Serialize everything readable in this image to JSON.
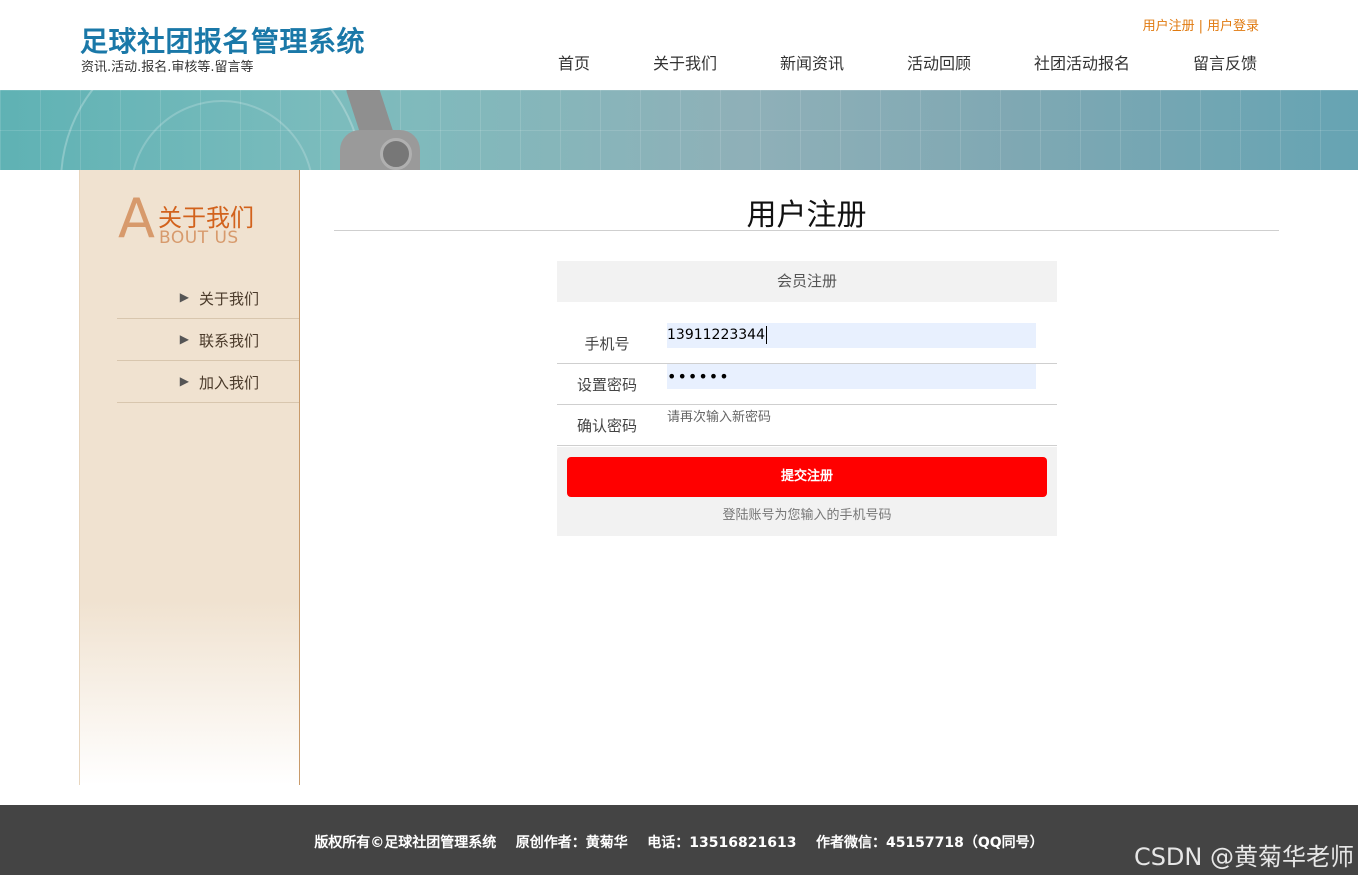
{
  "header": {
    "site_title": "足球社团报名管理系统",
    "site_subtitle": "资讯.活动.报名.审核等.留言等",
    "top_links": {
      "register": "用户注册",
      "separator": "|",
      "login": "用户登录"
    },
    "nav": [
      "首页",
      "关于我们",
      "新闻资讯",
      "活动回顾",
      "社团活动报名",
      "留言反馈"
    ]
  },
  "sidebar": {
    "big_letter": "A",
    "title_cn": "关于我们",
    "title_en": "BOUT US",
    "items": [
      {
        "label": "关于我们"
      },
      {
        "label": "联系我们"
      },
      {
        "label": "加入我们"
      }
    ]
  },
  "main": {
    "title": "用户注册",
    "form": {
      "header": "会员注册",
      "phone_label": "手机号",
      "phone_value": "13911223344",
      "password_label": "设置密码",
      "password_value": "••••••",
      "confirm_label": "确认密码",
      "confirm_placeholder": "请再次输入新密码",
      "submit_label": "提交注册",
      "hint": "登陆账号为您输入的手机号码"
    }
  },
  "footer": {
    "copyright": "版权所有©足球社团管理系统    原创作者：黄菊华    电话：13516821613    作者微信：45157718（QQ同号）",
    "watermark": "CSDN @黄菊华老师"
  },
  "colors": {
    "title_blue": "#1a78a8",
    "link_orange": "#e07a10",
    "submit_red": "#ff0000",
    "footer_bg": "#444444"
  }
}
